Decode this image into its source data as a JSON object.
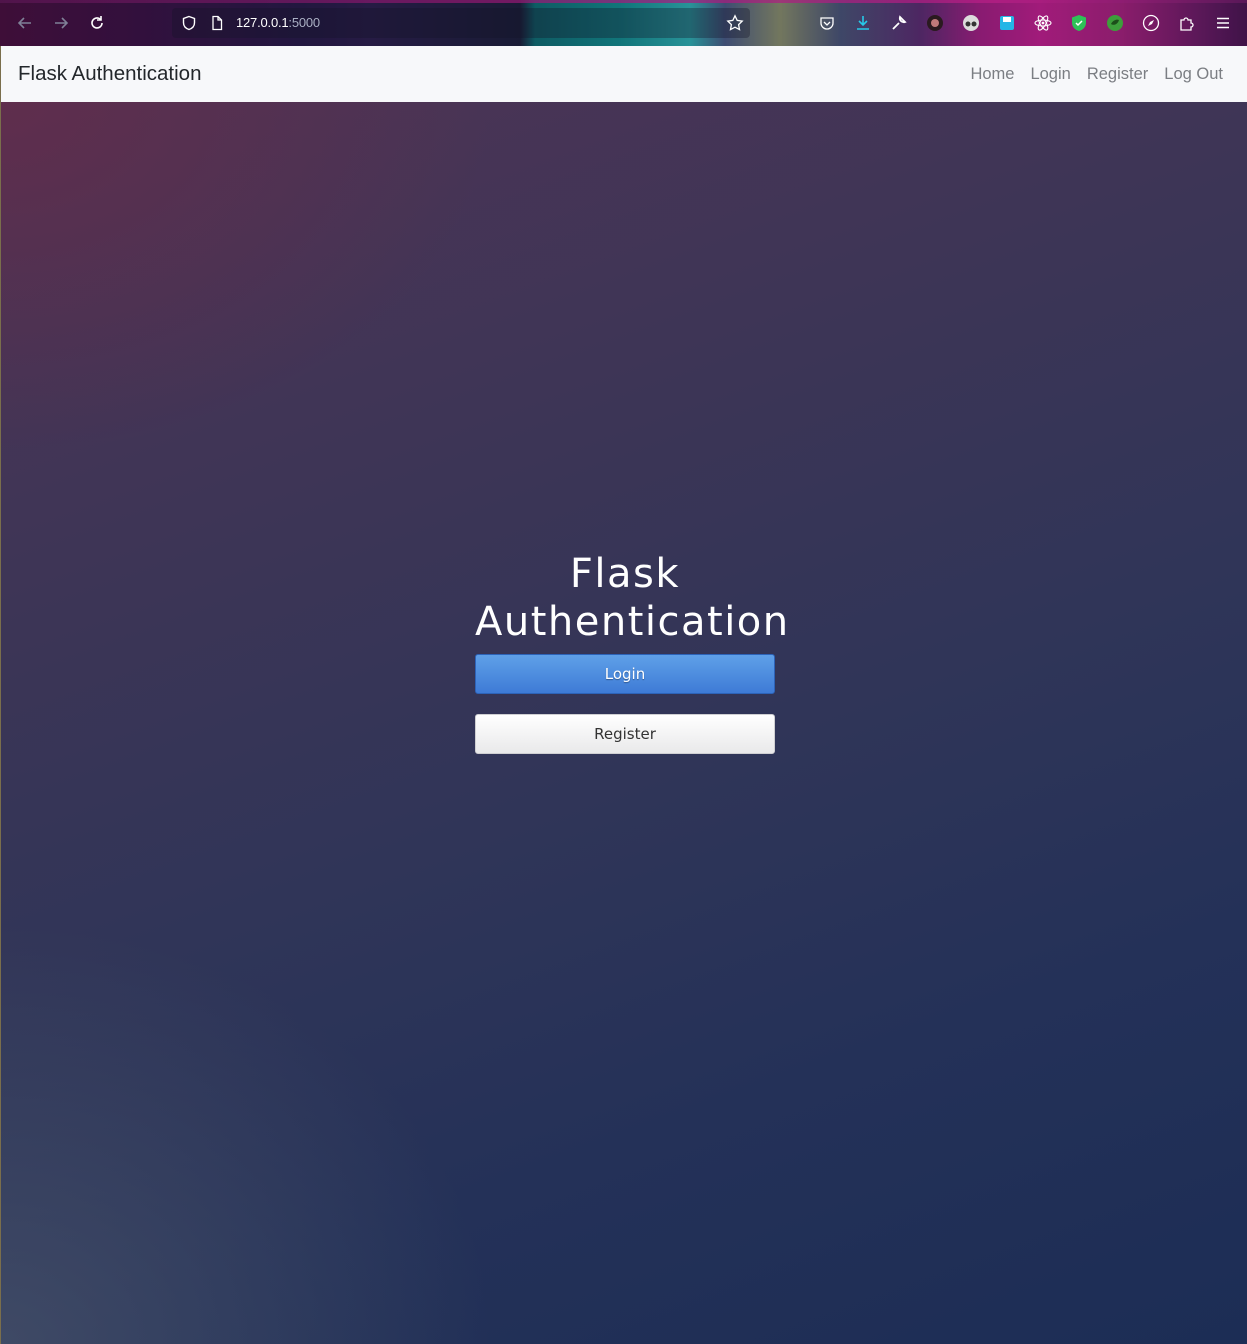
{
  "browser": {
    "url_host": "127.0.0.1",
    "url_port": ":5000",
    "icons": [
      "back-icon",
      "forward-icon",
      "reload-icon",
      "shield-icon",
      "page-icon",
      "bookmark-star-icon",
      "pocket-icon",
      "download-icon",
      "wrench-icon",
      "extension-dark-icon",
      "extension-glasses-icon",
      "save-icon",
      "react-icon",
      "green-shield-icon",
      "green-circle-icon",
      "compass-icon",
      "puzzle-icon",
      "menu-icon"
    ]
  },
  "navbar": {
    "brand": "Flask Authentication",
    "links": [
      {
        "label": "Home"
      },
      {
        "label": "Login"
      },
      {
        "label": "Register"
      },
      {
        "label": "Log Out"
      }
    ]
  },
  "hero": {
    "title": "Flask Authentication",
    "login_label": "Login",
    "register_label": "Register"
  },
  "colors": {
    "primary_button": "#3e7bd6",
    "navbar_bg": "#f7f8fa"
  }
}
